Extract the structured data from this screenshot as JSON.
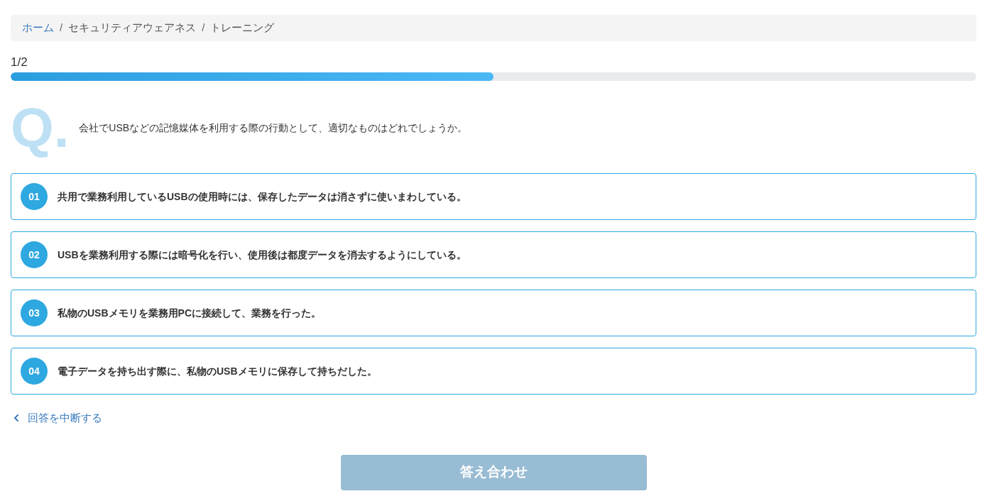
{
  "breadcrumb": [
    {
      "label": "ホーム",
      "link": true
    },
    {
      "label": "セキュリティアウェアネス",
      "link": false
    },
    {
      "label": "トレーニング",
      "link": false
    }
  ],
  "breadcrumb_separator": "/",
  "progress": {
    "label": "1/2",
    "level": 0.5
  },
  "question": {
    "mark": "Q.",
    "text": "会社でUSBなどの記憶媒体を利用する際の行動として、適切なものはどれでしょうか。"
  },
  "options": [
    {
      "number": "01",
      "text": "共用で業務利用しているUSBの使用時には、保存したデータは消さずに使いまわしている。"
    },
    {
      "number": "02",
      "text": "USBを業務利用する際には暗号化を行い、使用後は都度データを消去するようにしている。"
    },
    {
      "number": "03",
      "text": "私物のUSBメモリを業務用PCに接続して、業務を行った。"
    },
    {
      "number": "04",
      "text": "電子データを持ち出す際に、私物のUSBメモリに保存して持ちだした。"
    }
  ],
  "back_link": "回答を中断する",
  "submit": {
    "label": "答え合わせ",
    "disabled": true
  }
}
